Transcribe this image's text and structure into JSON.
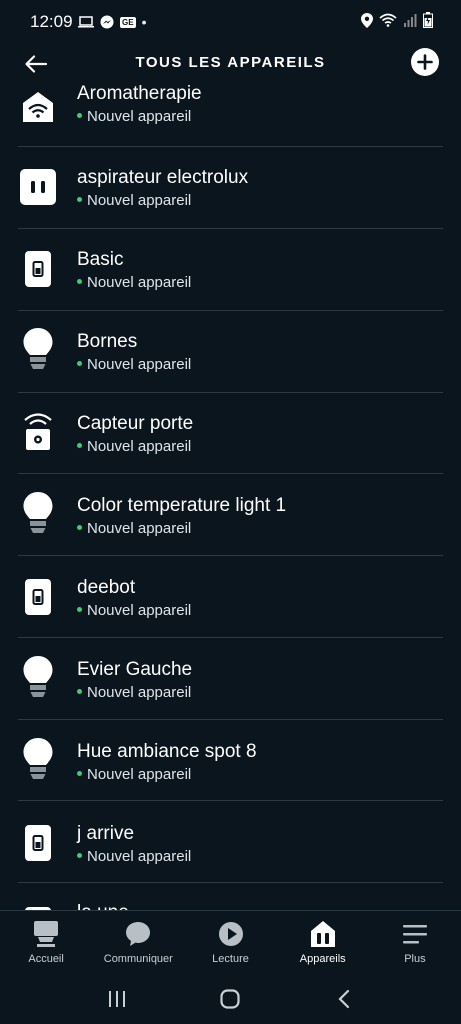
{
  "status_bar": {
    "time": "12:09",
    "ge_badge": "GE",
    "dot": "•"
  },
  "header": {
    "title": "TOUS LES APPAREILS"
  },
  "devices": [
    {
      "name": "Aromatherapie",
      "status": "Nouvel appareil",
      "icon": "house-wifi-icon"
    },
    {
      "name": "aspirateur electrolux",
      "status": "Nouvel appareil",
      "icon": "plug-icon"
    },
    {
      "name": "Basic",
      "status": "Nouvel appareil",
      "icon": "switch-icon"
    },
    {
      "name": "Bornes",
      "status": "Nouvel appareil",
      "icon": "bulb-icon"
    },
    {
      "name": "Capteur porte",
      "status": "Nouvel appareil",
      "icon": "sensor-icon"
    },
    {
      "name": "Color temperature light 1",
      "status": "Nouvel appareil",
      "icon": "bulb-icon"
    },
    {
      "name": "deebot",
      "status": "Nouvel appareil",
      "icon": "switch-icon"
    },
    {
      "name": "Evier Gauche",
      "status": "Nouvel appareil",
      "icon": "bulb-icon"
    },
    {
      "name": "Hue ambiance spot 8",
      "status": "Nouvel appareil",
      "icon": "bulb-icon"
    },
    {
      "name": "j arrive",
      "status": "Nouvel appareil",
      "icon": "switch-icon"
    },
    {
      "name": "la une",
      "status": "",
      "icon": "switch-icon"
    }
  ],
  "bottom_nav": {
    "tabs": [
      {
        "label": "Accueil",
        "icon": "home-icon"
      },
      {
        "label": "Communiquer",
        "icon": "chat-icon"
      },
      {
        "label": "Lecture",
        "icon": "play-icon"
      },
      {
        "label": "Appareils",
        "icon": "devices-icon"
      },
      {
        "label": "Plus",
        "icon": "menu-icon"
      }
    ]
  },
  "colors": {
    "background": "#0b151d",
    "divider": "#2c3a44",
    "status_dot": "#3bcf6e"
  }
}
